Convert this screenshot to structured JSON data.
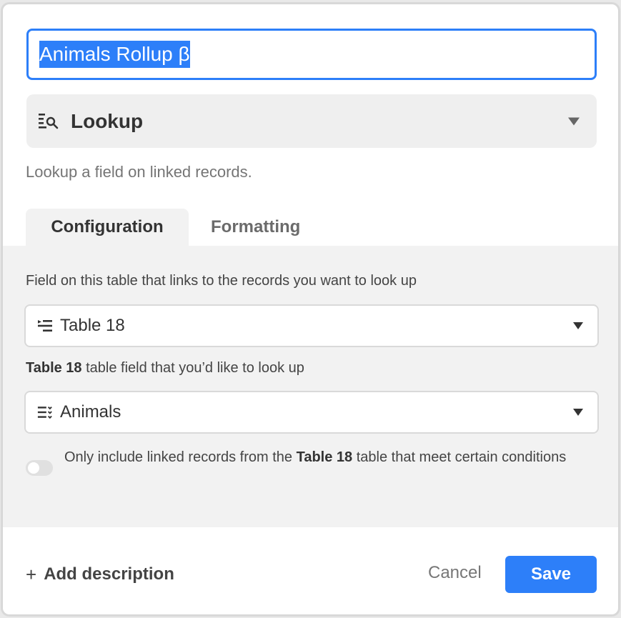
{
  "field_name": {
    "value": "Animals Rollup β"
  },
  "field_type": {
    "label": "Lookup",
    "icon": "lookup-icon",
    "description": "Lookup a field on linked records."
  },
  "tabs": [
    {
      "label": "Configuration",
      "active": true
    },
    {
      "label": "Formatting",
      "active": false
    }
  ],
  "configuration": {
    "link_field_label": "Field on this table that links to the records you want to look up",
    "link_field_value": "Table 18",
    "link_field_icon": "linked-record-icon",
    "lookup_field_label_table": "Table 18",
    "lookup_field_label_rest": " table field that you’d like to look up",
    "lookup_field_value": "Animals",
    "lookup_field_icon": "multiselect-icon",
    "condition_toggle": {
      "enabled": false,
      "text_before": "Only include linked records from the ",
      "text_table": "Table 18",
      "text_after": " table that meet certain conditions"
    }
  },
  "footer": {
    "add_description": "Add description",
    "cancel": "Cancel",
    "save": "Save"
  },
  "colors": {
    "accent": "#2d7ff9",
    "panel_bg": "#f2f2f2"
  }
}
